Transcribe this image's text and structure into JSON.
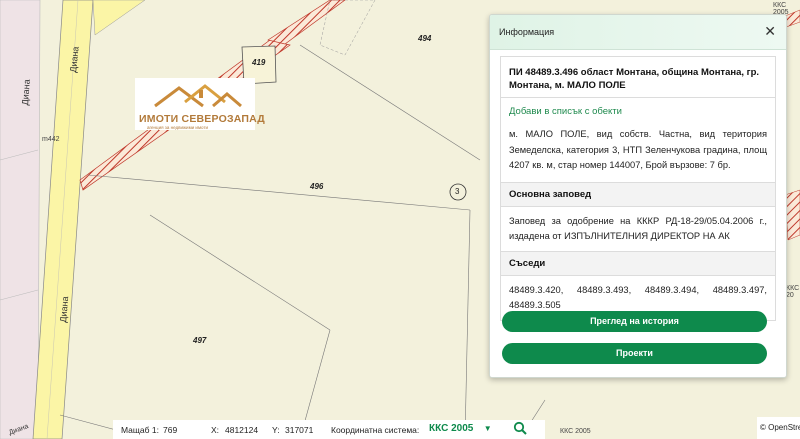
{
  "map": {
    "lots": [
      "494",
      "419",
      "496",
      "497",
      "3"
    ],
    "streets": [
      "Диана",
      "Диана",
      "Диана",
      "Диана"
    ],
    "small_label": "m442",
    "corner_label": "ККС 2005",
    "corner_label_bottom": "ККС 2005",
    "mid_label": "ККС 20",
    "colors": {
      "background": "#f3f1dc",
      "road": "#fbf5a6",
      "hatch": "#c0392b"
    }
  },
  "logo": {
    "title": "ИМОТИ СЕВЕРОЗАПАД",
    "subtitle": "агенция за недвижими имоти"
  },
  "panel": {
    "title": "Информация",
    "close_icon": "close-icon",
    "address": "ПИ 48489.3.496 област Монтана, община Монтана, гр. Монтана, м. МАЛО ПОЛЕ",
    "add_link": "Добави в списък с обекти",
    "description": "м. МАЛО ПОЛЕ, вид собств. Частна, вид територия Земеделска, категория 3, НТП Зеленчукова градина, площ 4207 кв. м, стар номер 144007, Брой вързове: 7 бр.",
    "order_header": "Основна заповед",
    "order_text": "Заповед за одобрение на КККР РД-18-29/05.04.2006 г., издадена от ИЗПЪЛНИТЕЛНИЯ ДИРЕКТОР НА АК",
    "neighbors_header": "Съседи",
    "neighbors_text": "48489.3.420, 48489.3.493, 48489.3.494, 48489.3.497, 48489.3.505",
    "history_button": "Преглед на история",
    "projects_button": "Проекти",
    "accent": "#0e8a4c"
  },
  "bottom": {
    "scale_label": "Мащаб 1:",
    "scale_value": "769",
    "x_label": "X:",
    "x_value": "4812124",
    "y_label": "Y:",
    "y_value": "317071",
    "crs_label": "Координатна система:",
    "crs_value": "ККС 2005",
    "search_icon": "search-icon"
  },
  "osm": {
    "text": "© OpenStreetMap"
  }
}
